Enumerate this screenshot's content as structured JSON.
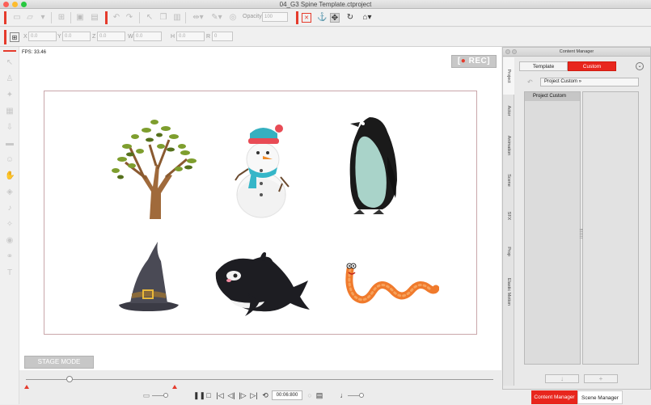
{
  "window": {
    "title": "04_G3 Spine Template.ctproject"
  },
  "toolbar": {
    "opacity_label": "Opacity",
    "opacity_value": "100"
  },
  "transform": {
    "x_label": "X",
    "x_value": "0.0",
    "y_label": "Y",
    "y_value": "0.0",
    "z_label": "Z",
    "z_value": "0.0",
    "w_label": "W",
    "w_value": "0.0",
    "h_label": "H",
    "h_value": "0.0",
    "r_label": "R",
    "r_value": "0"
  },
  "canvas": {
    "fps": "FPS: 33.46",
    "rec_label": "REC",
    "stage_mode_label": "STAGE MODE"
  },
  "timeline": {
    "timecode": "00:06:800"
  },
  "content_manager": {
    "title": "Content Manager",
    "vertical_tabs": [
      "Project",
      "Actor",
      "Animation",
      "Scene",
      "SFX",
      "Prop",
      "Elastic Motion"
    ],
    "tab_template": "Template",
    "tab_custom": "Custom",
    "path": "Project Custom »",
    "folder_item": "Project Custom",
    "down_button": "↓",
    "add_button": "+"
  },
  "bottom_tabs": {
    "content_manager": "Content Manager",
    "scene_manager": "Scene Manager"
  },
  "colors": {
    "accent": "#e8261d",
    "stage_border": "#c9a6aa"
  }
}
